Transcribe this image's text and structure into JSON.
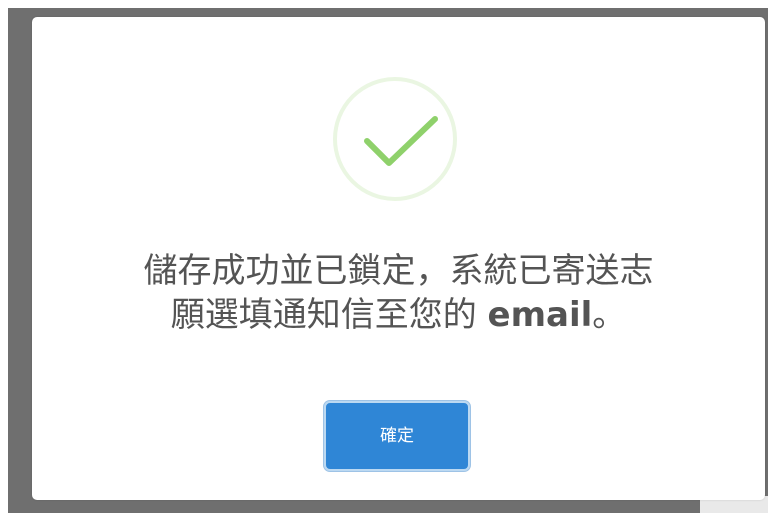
{
  "dialog": {
    "message_line1": "儲存成功並已鎖定，系統已寄送志",
    "message_line2_prefix": "願選填通知信至您的 ",
    "message_line2_bold": "email",
    "message_line2_suffix": "。",
    "confirm_label": "確定",
    "icon": "checkmark-icon"
  },
  "colors": {
    "success_green": "#8fd16b",
    "button_blue": "#2f86d6",
    "text_gray": "#545454"
  }
}
